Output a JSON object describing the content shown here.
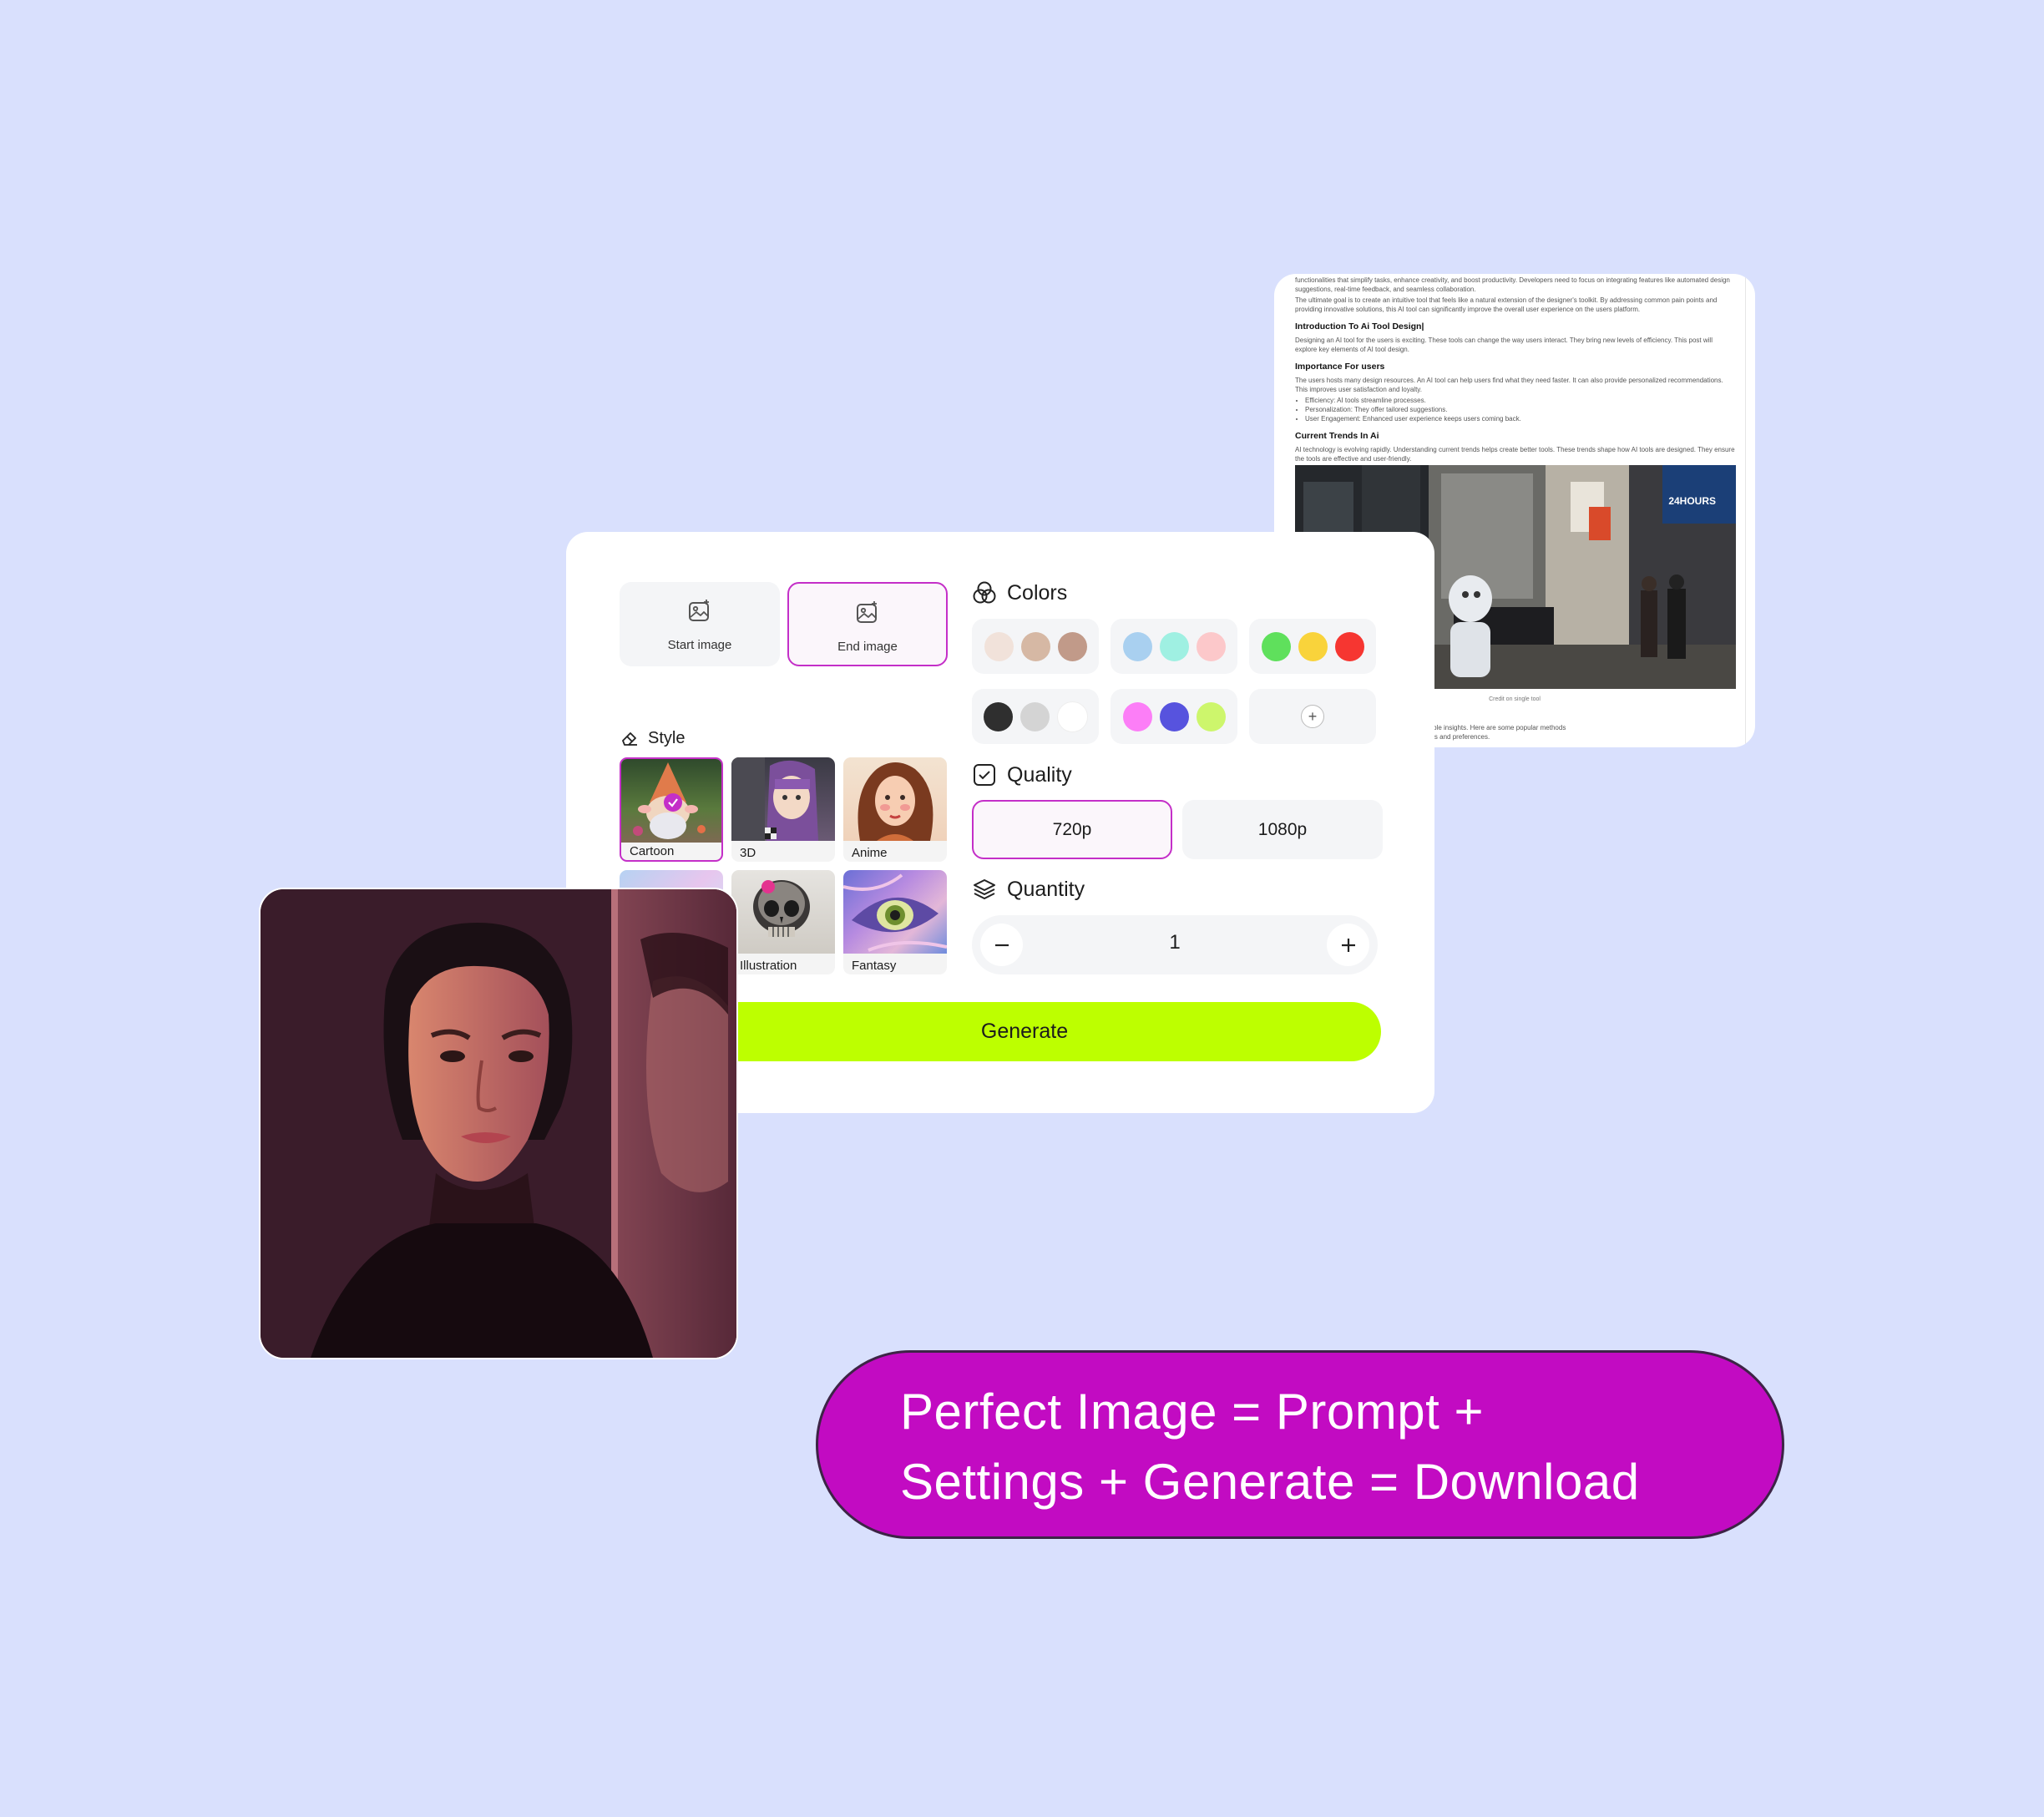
{
  "article": {
    "intro_lines": [
      "functionalities that simplify tasks, enhance creativity, and boost productivity. Developers need to focus on integrating features like automated design suggestions, real-time feedback, and seamless collaboration.",
      "The ultimate goal is to create an intuitive tool that feels like a natural extension of the designer's toolkit. By addressing common pain points and providing innovative solutions, this AI tool can significantly improve the overall user experience on the  users platform."
    ],
    "section1_title": "Introduction To Ai Tool Design|",
    "section1_text": "Designing an AI tool for the  users is exciting. These tools can change the way users interact. They bring new levels of efficiency. This post will explore key elements of AI tool design.",
    "section2_title": "Importance For  users",
    "section2_text": "The  users hosts many design resources. An AI tool can help users find what they need faster. It can also provide personalized recommendations. This improves user satisfaction and loyalty.",
    "bullets": [
      "Efficiency: AI tools streamline processes.",
      "Personalization: They offer tailored suggestions.",
      "User Engagement: Enhanced user experience keeps users coming back."
    ],
    "section3_title": "Current Trends In Ai",
    "section3_text": "AI technology is evolving rapidly. Understanding current trends helps create better tools. These trends shape how AI tools are designed. They ensure the tools are effective and user-friendly.",
    "photo_sign": "24HOURS",
    "photo_caption": "Credit on single tool",
    "tail_text": [
      "aluable insights. Here are some popular methods",
      "inions and preferences."
    ]
  },
  "panel": {
    "start_image_label": "Start image",
    "end_image_label": "End image",
    "style_title": "Style",
    "styles": [
      {
        "label": "Cartoon",
        "selected": true
      },
      {
        "label": "3D"
      },
      {
        "label": "Anime"
      },
      {
        "label": ""
      },
      {
        "label": "Illustration"
      },
      {
        "label": "Fantasy"
      }
    ],
    "colors_title": "Colors",
    "color_groups": [
      [
        "#f1e2da",
        "#d6b8a4",
        "#c19a89"
      ],
      [
        "#a9d0f0",
        "#9ff0e2",
        "#fcc8ca"
      ],
      [
        "#5fe05c",
        "#f9d33b",
        "#f63631"
      ],
      [
        "#2f2f2f",
        "#d4d4d4",
        "#ffffff"
      ],
      [
        "#fc7ef7",
        "#5753de",
        "#cdf66c"
      ]
    ],
    "quality_title": "Quality",
    "quality_options": [
      {
        "label": "720p",
        "selected": true
      },
      {
        "label": "1080p"
      }
    ],
    "quantity_title": "Quantity",
    "quantity_value": "1",
    "generate_label": "Generate"
  },
  "formula": {
    "line1": "Perfect Image = Prompt +",
    "line2": "Settings + Generate = Download"
  },
  "colors": {
    "background": "#d9e0fd",
    "accent_magenta": "#c20bc2",
    "generate_lime": "#bdff00",
    "selection_border": "#c42fc8"
  }
}
